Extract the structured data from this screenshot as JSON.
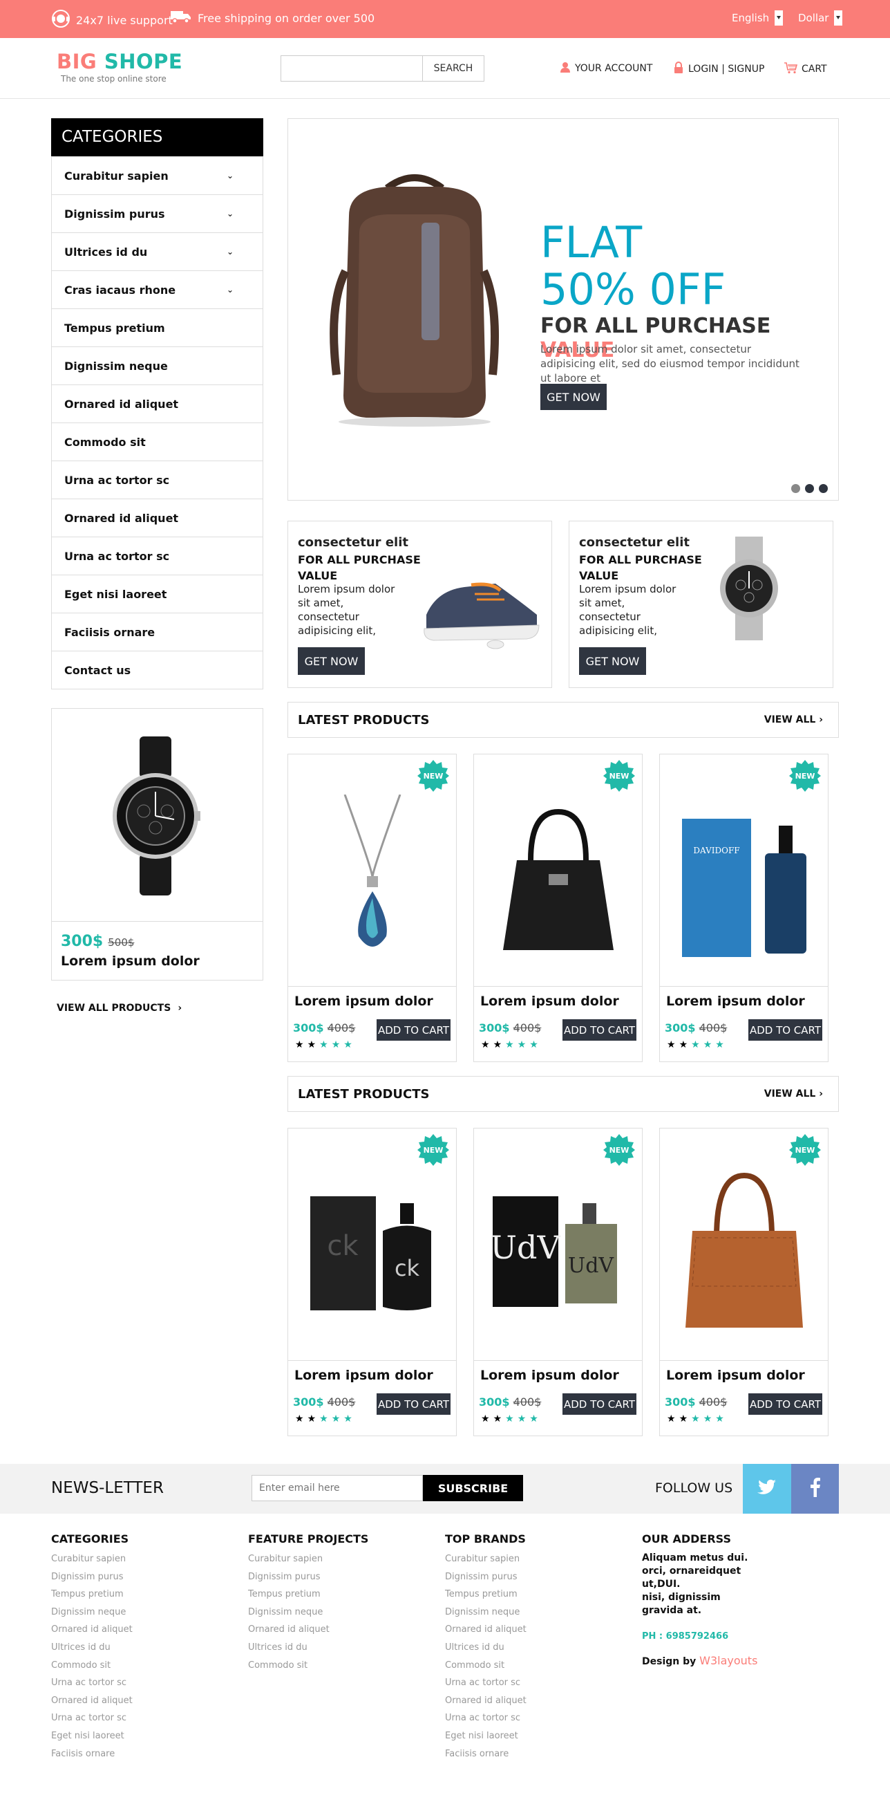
{
  "topbar": {
    "support": "24x7 live support",
    "shipping": "Free shipping on order over 500",
    "language": "English",
    "currency": "Dollar"
  },
  "header": {
    "logo_part1": "BIG",
    "logo_part2": "SHOPE",
    "tagline": "The one stop online store",
    "search_button": "SEARCH",
    "search_placeholder": "",
    "account": "YOUR ACCOUNT",
    "login": "LOGIN | SIGNUP",
    "cart": "CART"
  },
  "sidebar": {
    "heading": "CATEGORIES",
    "items": [
      {
        "label": "Curabitur sapien",
        "has_arrow": true
      },
      {
        "label": "Dignissim purus",
        "has_arrow": true
      },
      {
        "label": "Ultrices id du",
        "has_arrow": true
      },
      {
        "label": "Cras iacaus rhone",
        "has_arrow": true
      },
      {
        "label": "Tempus pretium",
        "has_arrow": false
      },
      {
        "label": "Dignissim neque",
        "has_arrow": false
      },
      {
        "label": "Ornared id aliquet",
        "has_arrow": false
      },
      {
        "label": "Commodo sit",
        "has_arrow": false
      },
      {
        "label": "Urna ac tortor sc",
        "has_arrow": false
      },
      {
        "label": "Ornared id aliquet",
        "has_arrow": false
      },
      {
        "label": "Urna ac tortor sc",
        "has_arrow": false
      },
      {
        "label": "Eget nisi laoreet",
        "has_arrow": false
      },
      {
        "label": "Faciisis ornare",
        "has_arrow": false
      },
      {
        "label": "Contact us",
        "has_arrow": false
      }
    ],
    "featured": {
      "price": "300$",
      "old_price": "500$",
      "name": "Lorem ipsum dolor",
      "icon": "watch-image"
    },
    "view_all": "VIEW ALL PRODUCTS"
  },
  "banner": {
    "headline": "FLAT 50% 0FF",
    "sub_prefix": "FOR ALL PURCHASE",
    "sub_highlight": "VALUE",
    "text": "Lorem ipsum dolor sit amet, consectetur adipisicing elit, sed do eiusmod tempor incididunt ut labore et",
    "button": "GET NOW",
    "slides": 3,
    "active_slide": 1,
    "image": "backpack-image"
  },
  "promos": [
    {
      "title": "consectetur elit",
      "subtitle": "FOR ALL PURCHASE VALUE",
      "text": "Lorem ipsum dolor sit amet, consectetur adipisicing elit,",
      "button": "GET NOW",
      "image": "sneaker-image"
    },
    {
      "title": "consectetur elit",
      "subtitle": "FOR ALL PURCHASE VALUE",
      "text": "Lorem ipsum dolor sit amet, consectetur adipisicing elit,",
      "button": "GET NOW",
      "image": "watch-image"
    }
  ],
  "sections": [
    {
      "title": "LATEST PRODUCTS",
      "view_all": "VIEW ALL",
      "products": [
        {
          "name": "Lorem ipsum dolor",
          "price": "300$",
          "old_price": "400$",
          "badge": "NEW",
          "button": "ADD TO CART",
          "rating": 2,
          "image": "pendant-image"
        },
        {
          "name": "Lorem ipsum dolor",
          "price": "300$",
          "old_price": "400$",
          "badge": "NEW",
          "button": "ADD TO CART",
          "rating": 2,
          "image": "handbag-image"
        },
        {
          "name": "Lorem ipsum dolor",
          "price": "300$",
          "old_price": "400$",
          "badge": "NEW",
          "button": "ADD TO CART",
          "rating": 2,
          "image": "perfume-image"
        }
      ]
    },
    {
      "title": "LATEST PRODUCTS",
      "view_all": "VIEW ALL",
      "products": [
        {
          "name": "Lorem ipsum dolor",
          "price": "300$",
          "old_price": "400$",
          "badge": "NEW",
          "button": "ADD TO CART",
          "rating": 2,
          "image": "ck-perfume-image"
        },
        {
          "name": "Lorem ipsum dolor",
          "price": "300$",
          "old_price": "400$",
          "badge": "NEW",
          "button": "ADD TO CART",
          "rating": 2,
          "image": "udv-perfume-image"
        },
        {
          "name": "Lorem ipsum dolor",
          "price": "300$",
          "old_price": "400$",
          "badge": "NEW",
          "button": "ADD TO CART",
          "rating": 2,
          "image": "leather-bag-image"
        }
      ]
    }
  ],
  "newsletter": {
    "title": "NEWS-LETTER",
    "placeholder": "Enter email here",
    "button": "SUBSCRIBE",
    "follow": "FOLLOW US"
  },
  "footer": {
    "categories": {
      "heading": "CATEGORIES",
      "links": [
        "Curabitur sapien",
        "Dignissim purus",
        "Tempus pretium",
        "Dignissim neque",
        "Ornared id aliquet",
        "Ultrices id du",
        "Commodo sit",
        "Urna ac tortor sc",
        "Ornared id aliquet",
        "Urna ac tortor sc",
        "Eget nisi laoreet",
        "Faciisis ornare"
      ]
    },
    "features": {
      "heading": "FEATURE PROJECTS",
      "links": [
        "Curabitur sapien",
        "Dignissim purus",
        "Tempus pretium",
        "Dignissim neque",
        "Ornared id aliquet",
        "Ultrices id du",
        "Commodo sit"
      ]
    },
    "brands": {
      "heading": "TOP BRANDS",
      "links": [
        "Curabitur sapien",
        "Dignissim purus",
        "Tempus pretium",
        "Dignissim neque",
        "Ornared id aliquet",
        "Ultrices id du",
        "Commodo sit",
        "Urna ac tortor sc",
        "Ornared id aliquet",
        "Urna ac tortor sc",
        "Eget nisi laoreet",
        "Faciisis ornare"
      ]
    },
    "address": {
      "heading": "OUR ADDERSS",
      "lines": [
        "Aliquam metus dui.",
        "orci, ornareidquet",
        "ut,DUI.",
        "nisi, dignissim",
        "gravida at."
      ],
      "phone": "PH : 6985792466",
      "design_by": "Design by",
      "designer": "W3layouts"
    }
  },
  "colors": {
    "accent": "#fa7d78",
    "teal": "#21b9a8",
    "blue": "#0aa6c7",
    "dark": "#2f3540",
    "twitter": "#5ec6ea",
    "facebook": "#6b86c4"
  }
}
